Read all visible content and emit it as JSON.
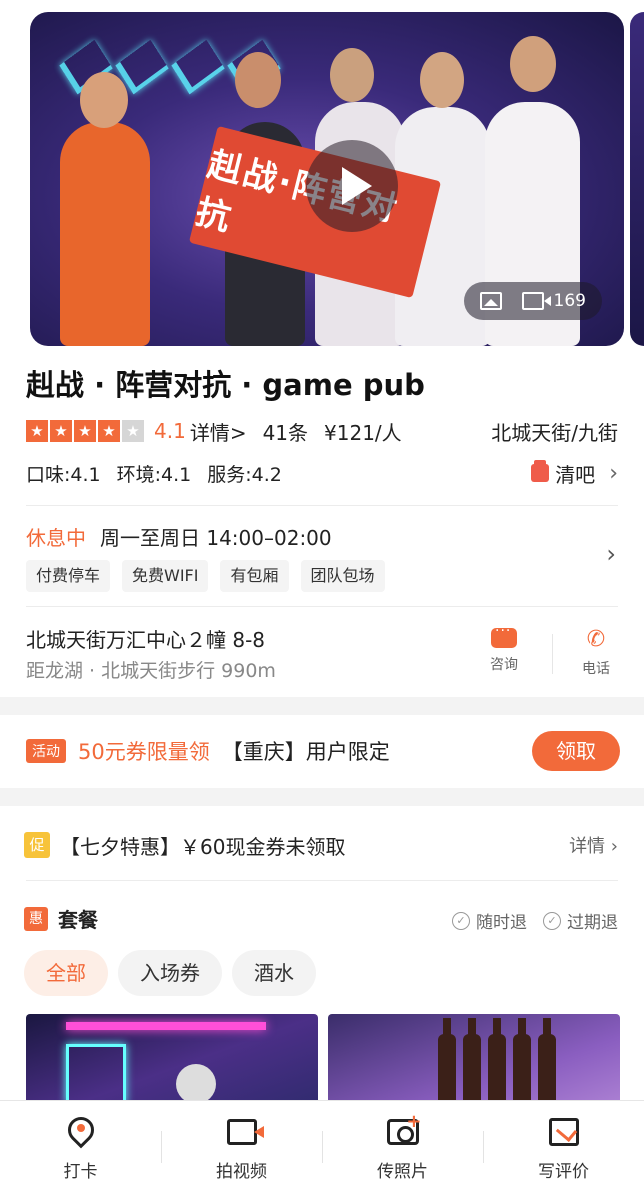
{
  "hero": {
    "sign_text": "赳战·阵营对抗",
    "photo_count": "169"
  },
  "shop": {
    "name": "赳战 · 阵营对抗 · game pub",
    "rating": "4.1",
    "details_label": "详情",
    "reviews": "41条",
    "price": "¥121/人",
    "area": "北城天街/九街",
    "scores": {
      "taste": "口味:4.1",
      "environment": "环境:4.1",
      "service": "服务:4.2"
    },
    "category": "清吧",
    "status": "休息中",
    "hours": "周一至周日 14:00–02:00",
    "tags": [
      "付费停车",
      "免费WIFI",
      "有包厢",
      "团队包场"
    ],
    "address": "北城天街万汇中心２幢 8-8",
    "distance": "距龙湖 · 北城天街步行 990m",
    "consult_label": "咨询",
    "phone_label": "电话"
  },
  "activity": {
    "badge": "活动",
    "highlight": "50元券限量领",
    "text": "【重庆】用户限定",
    "button": "领取"
  },
  "promo": {
    "badge": "促",
    "text": "【七夕特惠】￥60现金券未领取",
    "more": "详情"
  },
  "package": {
    "badge": "惠",
    "title": "套餐",
    "policies": [
      "随时退",
      "过期退"
    ],
    "filters": [
      "全部",
      "入场券",
      "酒水"
    ]
  },
  "tabbar": {
    "items": [
      "打卡",
      "拍视频",
      "传照片",
      "写评价"
    ]
  },
  "colors": {
    "accent": "#f26a3a",
    "promo_yellow": "#f7c33a"
  }
}
